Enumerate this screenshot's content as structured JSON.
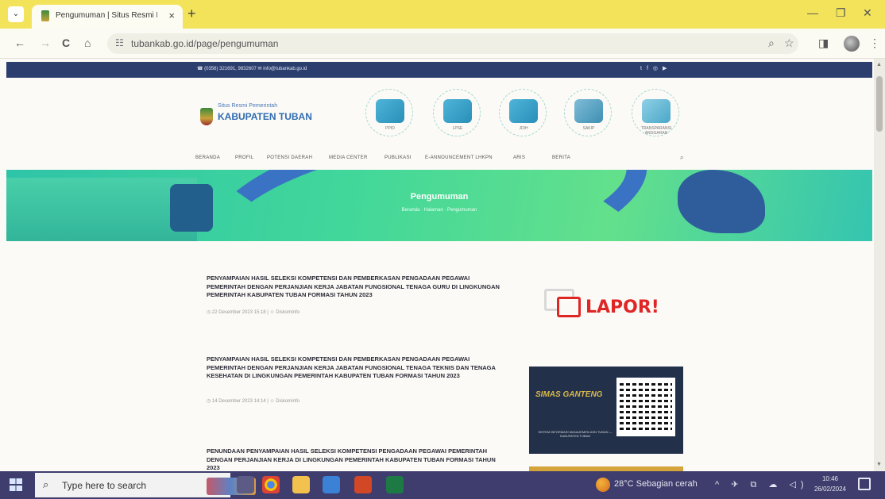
{
  "browser": {
    "tab_title": "Pengumuman | Situs Resmi Pe",
    "tab_close": "×",
    "new_tab": "+",
    "url": "tubankab.go.id/page/pengumuman",
    "icons": [
      "tab-list-icon",
      "back-icon",
      "forward-icon",
      "reload-icon",
      "home-icon",
      "site-info-icon",
      "zoom-icon",
      "bookmark-star-icon",
      "side-panel-icon",
      "profile-avatar",
      "menu-kebab-icon",
      "minimize-icon",
      "restore-icon",
      "close-window-icon"
    ]
  },
  "site": {
    "topbar": {
      "contact": "☎ (0356) 321691, 9832607   ✉ info@tubankab.go.id",
      "social_icons": [
        "twitter-icon",
        "facebook-icon",
        "instagram-icon",
        "youtube-icon"
      ]
    },
    "logo": {
      "subtitle": "Situs Resmi Pemerintah",
      "title": "KABUPATEN TUBAN"
    },
    "feature_icons": [
      {
        "label": "PPID"
      },
      {
        "label": "LPSE"
      },
      {
        "label": "JDIH"
      },
      {
        "label": "SAKIP"
      },
      {
        "label": "TRANSPARANSI ANGGARAN"
      }
    ],
    "menu": [
      "BERANDA",
      "PROFIL",
      "POTENSI DAERAH",
      "MEDIA CENTER",
      "PUBLIKASI",
      "E-ANNOUNCEMENT LHKPN",
      "ARIS",
      "BERITA"
    ],
    "hero": {
      "title": "Pengumuman",
      "breadcrumb": "Beranda  ·  Halaman  ·  Pengumuman"
    },
    "posts": [
      {
        "title": "PENYAMPAIAN HASIL SELEKSI KOMPETENSI DAN PEMBERKASAN PENGADAAN PEGAWAI PEMERINTAH DENGAN PERJANJIAN KERJA JABATAN FUNGSIONAL TENAGA GURU DI LINGKUNGAN PEMERINTAH KABUPATEN TUBAN FORMASI TAHUN 2023",
        "meta": "◷ 22 Desember 2023 15:18   |   ☺ Diskominfo"
      },
      {
        "title": "PENYAMPAIAN HASIL SELEKSI KOMPETENSI DAN PEMBERKASAN PENGADAAN PEGAWAI PEMERINTAH DENGAN PERJANJIAN KERJA JABATAN FUNGSIONAL TENAGA TEKNIS DAN TENAGA KESEHATAN DI LINGKUNGAN PEMERINTAH KABUPATEN TUBAN FORMASI TAHUN 2023",
        "meta": "◷ 14 Desember 2023 14:14   |   ☺ Diskominfo"
      },
      {
        "title": "PENUNDAAN PENYAMPAIAN HASIL SELEKSI KOMPETENSI PENGADAAN PEGAWAI PEMERINTAH DENGAN PERJANJIAN KERJA DI LINGKUNGAN PEMERINTAH KABUPATEN TUBAN FORMASI TAHUN 2023",
        "meta": ""
      }
    ],
    "sidebar": {
      "lapor": "LAPOR!",
      "simas_logo": "SIMAS GANTENG",
      "simas_sub": "SISTEM INFORMASI MANAJEMEN ASN TUBAN — KABUPATEN TUBAN"
    }
  },
  "taskbar": {
    "search_placeholder": "Type here to search",
    "weather": "28°C  Sebagian cerah",
    "time": "10:46",
    "date": "26/02/2024",
    "pinned_apps": [
      "task-view-icon",
      "chrome-icon",
      "file-explorer-icon",
      "store-icon",
      "powerpoint-icon",
      "excel-icon"
    ]
  }
}
